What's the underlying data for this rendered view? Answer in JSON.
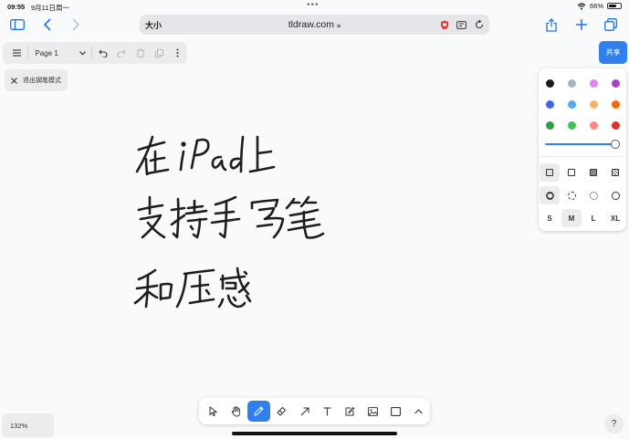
{
  "status_bar": {
    "time": "09:55",
    "date": "9月11日周一",
    "battery": "66%",
    "battery_level": 0.66
  },
  "browser": {
    "text_size_label": "大小",
    "url": "tldraw.com"
  },
  "app": {
    "page_name": "Page 1",
    "exit_pen_mode": "退出钢笔模式",
    "share_label": "共享",
    "zoom": "132%",
    "help_label": "?"
  },
  "style_panel": {
    "colors": [
      "#1d1d1d",
      "#adb5bd",
      "#e085f4",
      "#ae3ec9",
      "#4263eb",
      "#4dabf7",
      "#f8b26a",
      "#f76707",
      "#2f9e44",
      "#40c057",
      "#ff8787",
      "#e03131"
    ],
    "selected_color": "#1d1d1d",
    "accent": "#2f80ed",
    "opacity": 1.0,
    "sizes": [
      "S",
      "M",
      "L",
      "XL"
    ],
    "selected_size": "M"
  },
  "canvas_text": {
    "line1": "在iPad上",
    "line2": "支持手写笔",
    "line3": "和压感"
  },
  "tools": [
    "select",
    "hand",
    "draw",
    "eraser",
    "arrow",
    "text",
    "note",
    "asset",
    "rectangle",
    "more"
  ],
  "active_tool": "draw"
}
